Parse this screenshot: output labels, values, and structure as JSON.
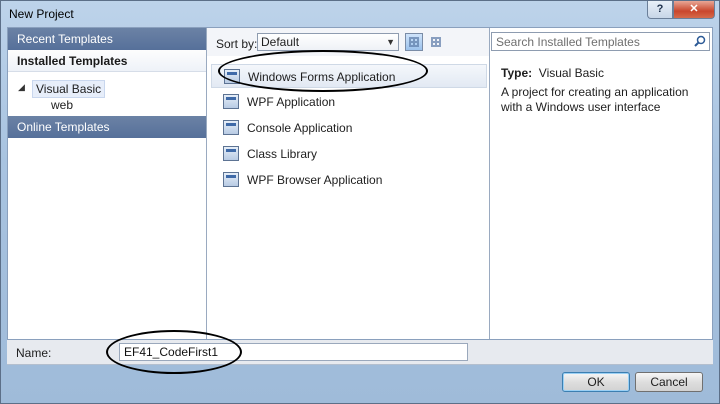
{
  "window": {
    "title": "New Project",
    "help_label": "?",
    "close_label": "✕"
  },
  "sidebar": {
    "recent_label": "Recent Templates",
    "installed_label": "Installed Templates",
    "tree_root": "Visual Basic",
    "tree_child": "web",
    "online_label": "Online Templates"
  },
  "sortbar": {
    "label": "Sort by:",
    "selected": "Default"
  },
  "templates": [
    {
      "label": "Windows Forms Application",
      "icon": "windows-forms-icon",
      "selected": true
    },
    {
      "label": "WPF Application",
      "icon": "wpf-app-icon",
      "selected": false
    },
    {
      "label": "Console Application",
      "icon": "console-app-icon",
      "selected": false
    },
    {
      "label": "Class Library",
      "icon": "class-library-icon",
      "selected": false
    },
    {
      "label": "WPF Browser Application",
      "icon": "wpf-browser-icon",
      "selected": false
    }
  ],
  "search": {
    "placeholder": "Search Installed Templates"
  },
  "details": {
    "type_label": "Type:",
    "type_value": "Visual Basic",
    "description": "A project for creating an application with a Windows user interface"
  },
  "name_field": {
    "label": "Name:",
    "value": "EF41_CodeFirst1"
  },
  "buttons": {
    "ok": "OK",
    "cancel": "Cancel"
  }
}
